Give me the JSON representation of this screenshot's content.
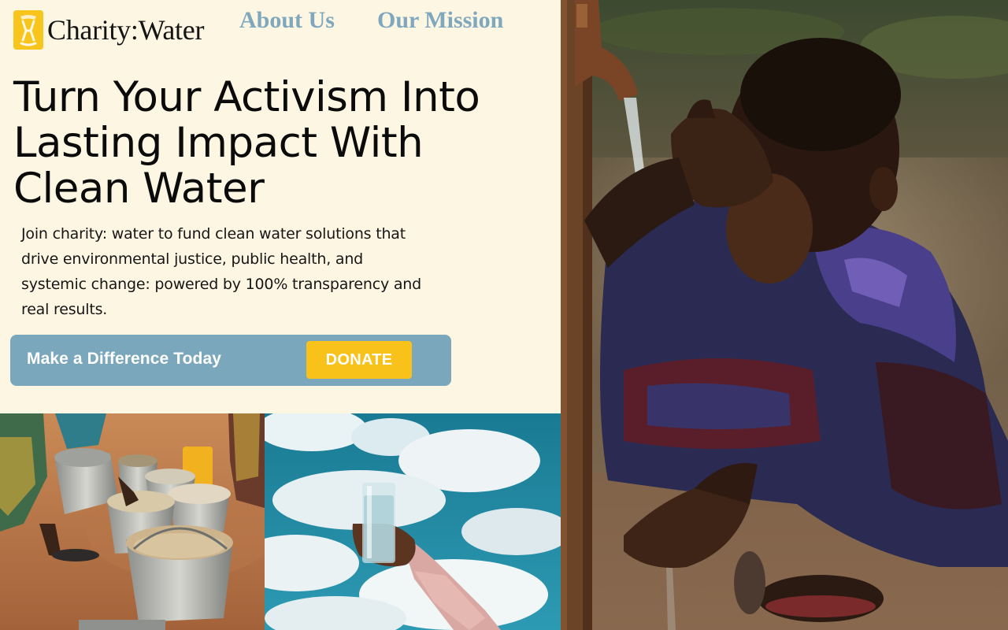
{
  "brand": {
    "name": "Charity:Water",
    "icon": "jerrycan-icon",
    "color": "#f7c51b"
  },
  "nav": {
    "items": [
      {
        "label": "About Us"
      },
      {
        "label": "Our Mission"
      }
    ],
    "link_color": "#7fa8bf"
  },
  "hero": {
    "headline": "Turn Your Activism Into Lasting Impact With Clean Water",
    "subtext": "Join charity: water to fund clean water solutions that drive environmental justice, public health, and systemic change: powered by 100% transparency and real results."
  },
  "cta": {
    "label": "Make a Difference Today",
    "button_label": "DONATE",
    "bar_color": "#7aa7bc",
    "button_color": "#f8c21a"
  },
  "images": [
    {
      "name": "buckets-photo"
    },
    {
      "name": "glass-sky-photo"
    },
    {
      "name": "boy-washing-photo"
    }
  ]
}
